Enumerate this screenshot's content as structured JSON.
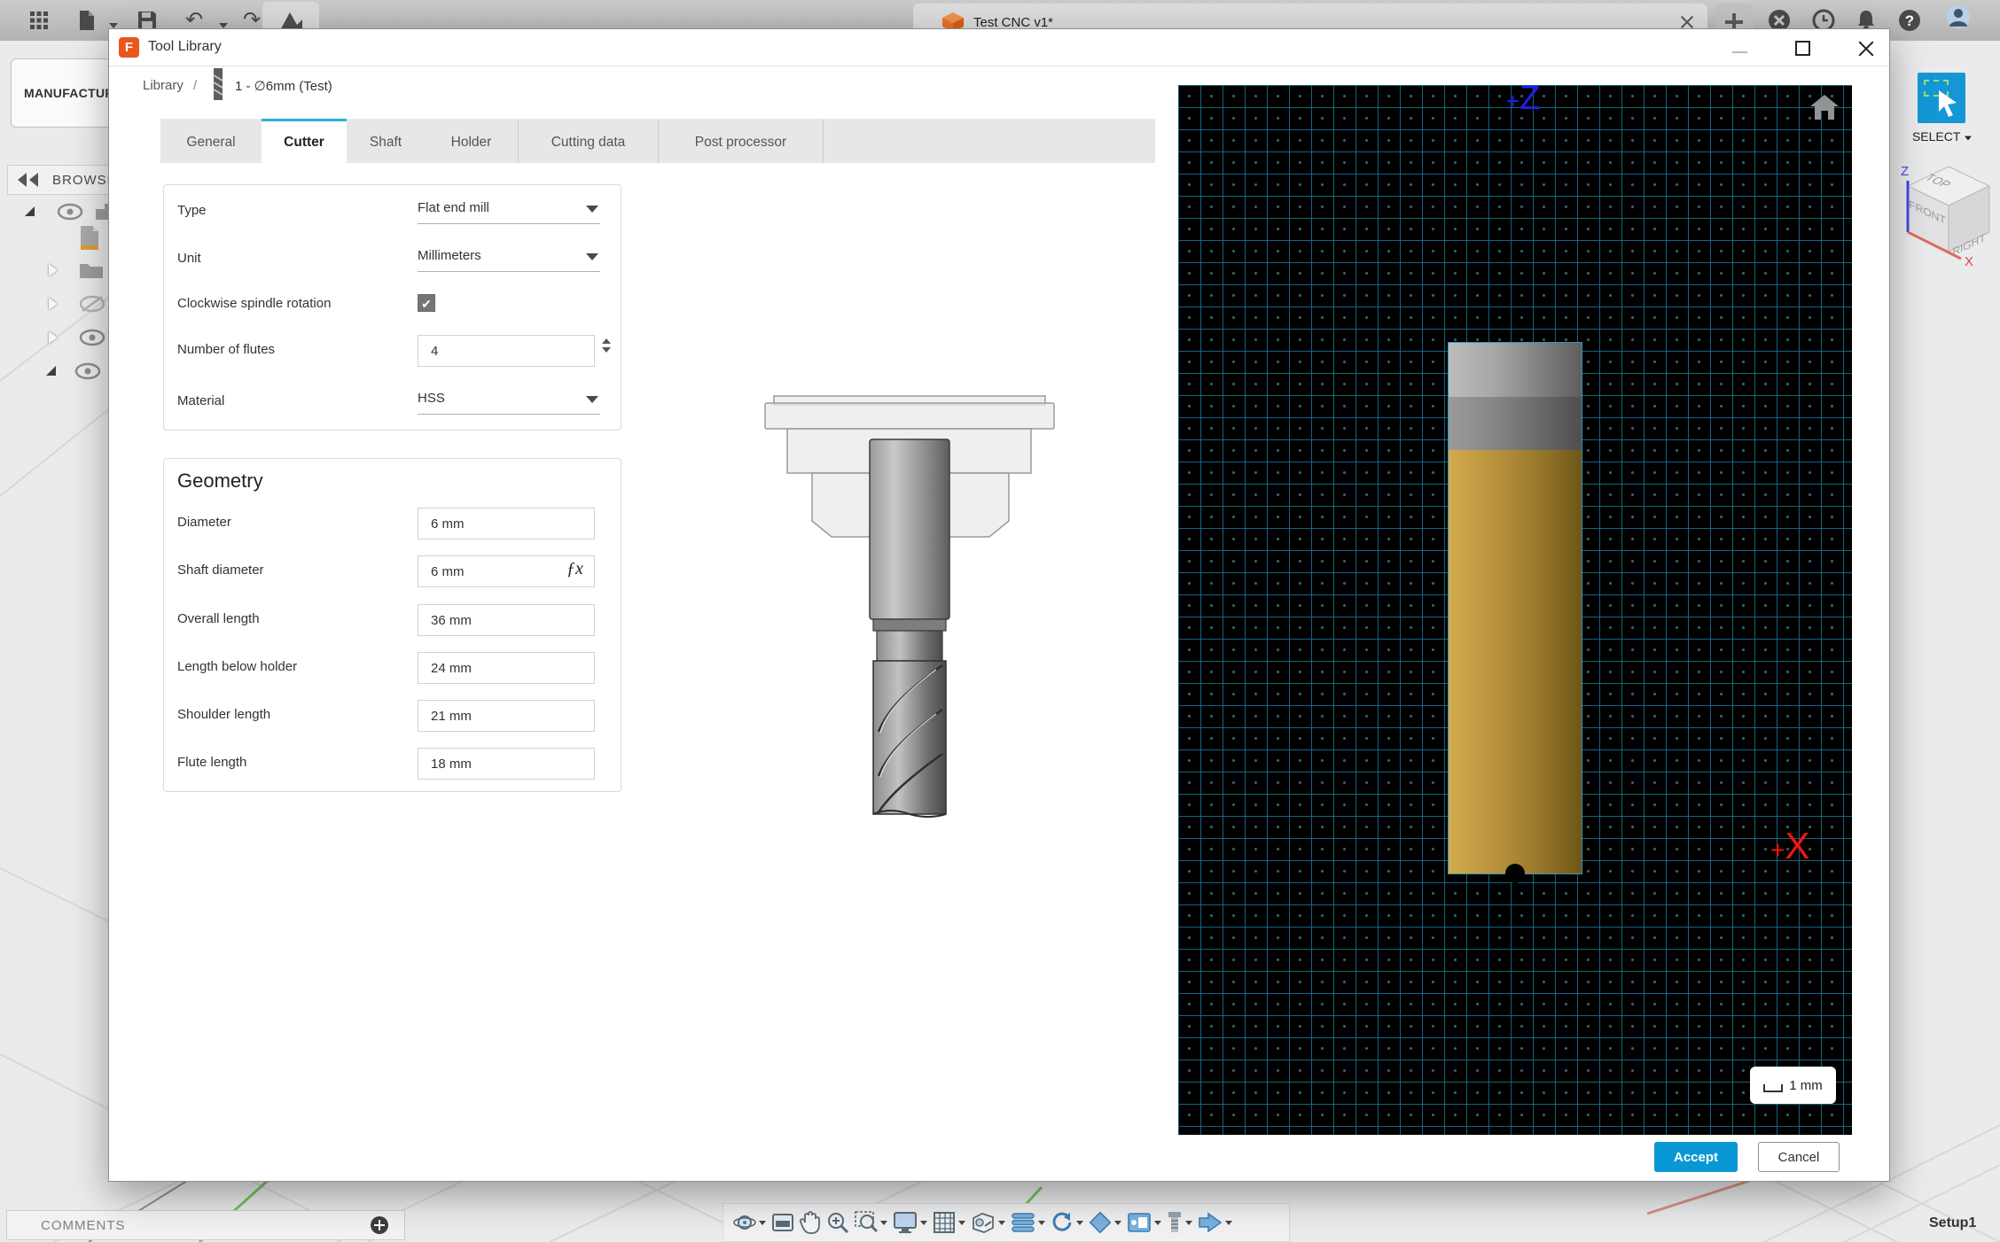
{
  "window": {
    "document_tab": "Test CNC v1*",
    "workspace_label": "MANUFACTURE",
    "browser_label": "BROWSER",
    "comments_label": "COMMENTS",
    "setup_label": "Setup1",
    "icons": {
      "undo_glyph": "↶",
      "redo_glyph": "↷",
      "help_glyph": "?"
    }
  },
  "dialog": {
    "title": "Tool Library",
    "breadcrumb": {
      "root": "Library",
      "separator": "/",
      "current": "1 - ∅6mm (Test)"
    },
    "tabs": [
      {
        "label": "General"
      },
      {
        "label": "Cutter"
      },
      {
        "label": "Shaft"
      },
      {
        "label": "Holder"
      },
      {
        "label": "Cutting data"
      },
      {
        "label": "Post processor"
      }
    ],
    "active_tab": "Cutter",
    "form": {
      "type": {
        "label": "Type",
        "value": "Flat end mill"
      },
      "unit": {
        "label": "Unit",
        "value": "Millimeters"
      },
      "spindle": {
        "label": "Clockwise spindle rotation",
        "checked": true,
        "glyph": "✔"
      },
      "flutes": {
        "label": "Number of flutes",
        "value": "4"
      },
      "material": {
        "label": "Material",
        "value": "HSS"
      }
    },
    "geometry": {
      "title": "Geometry",
      "rows": [
        {
          "label": "Diameter",
          "value": "6 mm"
        },
        {
          "label": "Shaft diameter",
          "value": "6 mm",
          "fx": "ƒx"
        },
        {
          "label": "Overall length",
          "value": "36 mm"
        },
        {
          "label": "Length below holder",
          "value": "24 mm"
        },
        {
          "label": "Shoulder length",
          "value": "21 mm"
        },
        {
          "label": "Flute length",
          "value": "18 mm"
        }
      ]
    },
    "viewport3d": {
      "z_plus": "+",
      "z_letter": "Z",
      "x_plus": "+",
      "x_letter": "X",
      "scale_label": "1 mm"
    },
    "buttons": {
      "accept": "Accept",
      "cancel": "Cancel"
    }
  },
  "right_panel": {
    "select_label": "SELECT",
    "viewcube": {
      "top": "TOP",
      "front": "FRONT",
      "right": "RIGHT",
      "z_axis": "Z",
      "x_axis": "X"
    }
  },
  "colors": {
    "accent_blue": "#0a97d5",
    "tab_highlight": "#2cb0e2",
    "grid_teal": "#167694",
    "tool_gold": "#bd9540",
    "axis_z_blue": "#1f1ff2",
    "axis_x_red": "#f01414",
    "fusion_orange": "#e8571c"
  },
  "nav_toolbar_icons": [
    {
      "name": "orbit",
      "caret": true
    },
    {
      "name": "look-at",
      "caret": false
    },
    {
      "name": "pan",
      "caret": false
    },
    {
      "name": "zoom",
      "caret": false
    },
    {
      "name": "zoom-window",
      "caret": true
    },
    {
      "name": "display-settings",
      "caret": true
    },
    {
      "name": "grid-and-snaps",
      "caret": true
    },
    {
      "name": "viewports",
      "caret": true
    },
    {
      "name": "toolpath",
      "caret": true
    },
    {
      "name": "regenerate",
      "caret": true
    },
    {
      "name": "stock",
      "caret": true
    },
    {
      "name": "machine",
      "caret": true
    },
    {
      "name": "tool",
      "caret": true
    },
    {
      "name": "post-process",
      "caret": true
    }
  ]
}
